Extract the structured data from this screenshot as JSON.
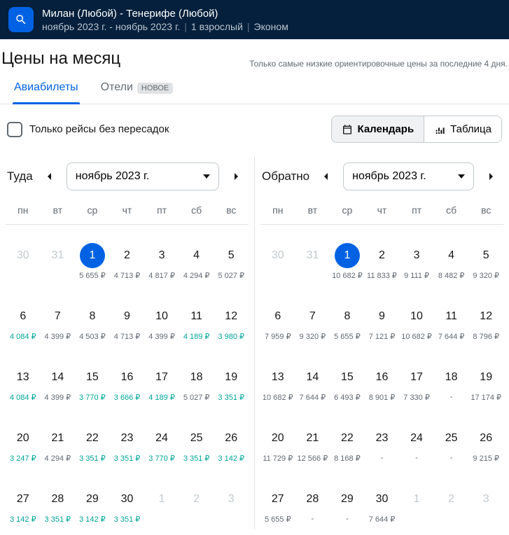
{
  "header": {
    "route": "Милан (Любой) - Тенерифе (Любой)",
    "dates": "ноябрь 2023 г. - ноябрь 2023 г.",
    "passengers": "1 взрослый",
    "cabin": "Эконом"
  },
  "title": "Цены на месяц",
  "subtitle": "Только самые низкие ориентировочные цены за последние 4 дня.",
  "tabs": {
    "flights": "Авиабилеты",
    "hotels": "Отели",
    "new_badge": "НОВОЕ"
  },
  "direct_only": "Только рейсы без пересадок",
  "view": {
    "calendar": "Календарь",
    "table": "Таблица"
  },
  "weekdays": [
    "пн",
    "вт",
    "ср",
    "чт",
    "пт",
    "сб",
    "вс"
  ],
  "outbound": {
    "label": "Туда",
    "month": "ноябрь 2023 г.",
    "days": [
      {
        "n": "30",
        "muted": true
      },
      {
        "n": "31",
        "muted": true
      },
      {
        "n": "1",
        "selected": true,
        "p": "5 655 ₽"
      },
      {
        "n": "2",
        "p": "4 713 ₽"
      },
      {
        "n": "3",
        "p": "4 817 ₽"
      },
      {
        "n": "4",
        "p": "4 294 ₽"
      },
      {
        "n": "5",
        "p": "5 027 ₽"
      },
      {
        "n": "6",
        "p": "4 084 ₽",
        "g": true
      },
      {
        "n": "7",
        "p": "4 399 ₽"
      },
      {
        "n": "8",
        "p": "4 503 ₽"
      },
      {
        "n": "9",
        "p": "4 713 ₽"
      },
      {
        "n": "10",
        "p": "4 399 ₽"
      },
      {
        "n": "11",
        "p": "4 189 ₽",
        "g": true
      },
      {
        "n": "12",
        "p": "3 980 ₽",
        "g": true
      },
      {
        "n": "13",
        "p": "4 084 ₽",
        "g": true
      },
      {
        "n": "14",
        "p": "4 399 ₽"
      },
      {
        "n": "15",
        "p": "3 770 ₽",
        "g": true
      },
      {
        "n": "16",
        "p": "3 666 ₽",
        "g": true
      },
      {
        "n": "17",
        "p": "4 189 ₽",
        "g": true
      },
      {
        "n": "18",
        "p": "5 027 ₽"
      },
      {
        "n": "19",
        "p": "3 351 ₽",
        "g": true
      },
      {
        "n": "20",
        "p": "3 247 ₽",
        "g": true
      },
      {
        "n": "21",
        "p": "4 294 ₽"
      },
      {
        "n": "22",
        "p": "3 351 ₽",
        "g": true
      },
      {
        "n": "23",
        "p": "3 351 ₽",
        "g": true
      },
      {
        "n": "24",
        "p": "3 770 ₽",
        "g": true
      },
      {
        "n": "25",
        "p": "3 351 ₽",
        "g": true
      },
      {
        "n": "26",
        "p": "3 142 ₽",
        "g": true
      },
      {
        "n": "27",
        "p": "3 142 ₽",
        "g": true
      },
      {
        "n": "28",
        "p": "3 351 ₽",
        "g": true
      },
      {
        "n": "29",
        "p": "3 142 ₽",
        "g": true
      },
      {
        "n": "30",
        "p": "3 351 ₽",
        "g": true
      },
      {
        "n": "1",
        "muted": true
      },
      {
        "n": "2",
        "muted": true
      },
      {
        "n": "3",
        "muted": true
      }
    ]
  },
  "return": {
    "label": "Обратно",
    "month": "ноябрь 2023 г.",
    "days": [
      {
        "n": "30",
        "muted": true
      },
      {
        "n": "31",
        "muted": true
      },
      {
        "n": "1",
        "selected": true,
        "p": "10 682 ₽"
      },
      {
        "n": "2",
        "p": "11 833 ₽"
      },
      {
        "n": "3",
        "p": "9 111 ₽"
      },
      {
        "n": "4",
        "p": "8 482 ₽"
      },
      {
        "n": "5",
        "p": "9 320 ₽"
      },
      {
        "n": "6",
        "p": "7 959 ₽"
      },
      {
        "n": "7",
        "p": "9 320 ₽"
      },
      {
        "n": "8",
        "p": "5 655 ₽"
      },
      {
        "n": "9",
        "p": "7 121 ₽"
      },
      {
        "n": "10",
        "p": "10 682 ₽"
      },
      {
        "n": "11",
        "p": "7 644 ₽"
      },
      {
        "n": "12",
        "p": "8 796 ₽"
      },
      {
        "n": "13",
        "p": "10 682 ₽"
      },
      {
        "n": "14",
        "p": "7 644 ₽"
      },
      {
        "n": "15",
        "p": "6 493 ₽"
      },
      {
        "n": "16",
        "p": "8 901 ₽"
      },
      {
        "n": "17",
        "p": "7 330 ₽"
      },
      {
        "n": "18",
        "p": "-"
      },
      {
        "n": "19",
        "p": "17 174 ₽"
      },
      {
        "n": "20",
        "p": "11 729 ₽"
      },
      {
        "n": "21",
        "p": "12 566 ₽"
      },
      {
        "n": "22",
        "p": "8 168 ₽"
      },
      {
        "n": "23",
        "p": "-"
      },
      {
        "n": "24",
        "p": "-"
      },
      {
        "n": "25",
        "p": "-"
      },
      {
        "n": "26",
        "p": "9 215 ₽"
      },
      {
        "n": "27",
        "p": "5 655 ₽"
      },
      {
        "n": "28",
        "p": "-"
      },
      {
        "n": "29",
        "p": "-"
      },
      {
        "n": "30",
        "p": "7 644 ₽"
      },
      {
        "n": "1",
        "muted": true
      },
      {
        "n": "2",
        "muted": true
      },
      {
        "n": "3",
        "muted": true
      }
    ]
  }
}
